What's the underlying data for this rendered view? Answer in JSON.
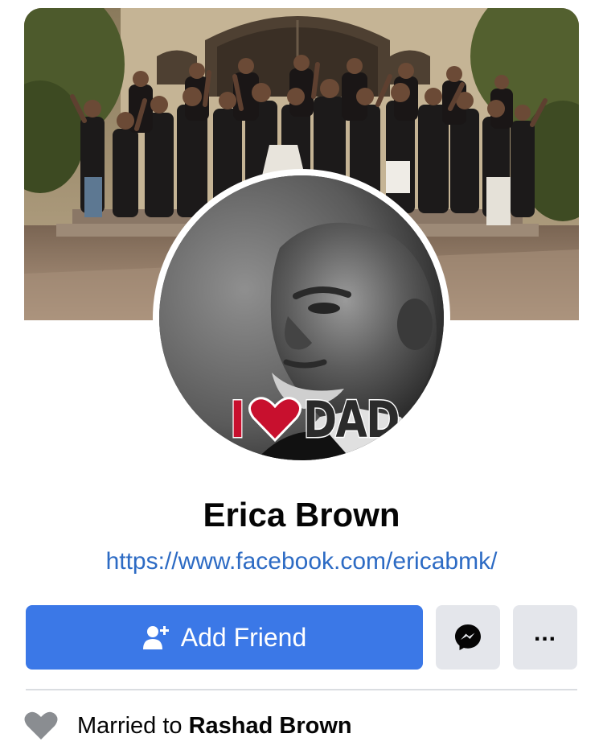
{
  "profile": {
    "name": "Erica Brown",
    "url": "https://www.facebook.com/ericabmk/",
    "avatar_badge": {
      "i": "I",
      "dad": "DAD"
    }
  },
  "actions": {
    "add_friend_label": "Add Friend",
    "add_friend_icon": "person-add-icon",
    "messenger_icon": "messenger-icon",
    "more_icon": "more-icon",
    "more_label": "..."
  },
  "details": {
    "relationship_prefix": "Married to",
    "relationship_partner": "Rashad Brown",
    "relationship_icon": "heart-icon"
  },
  "colors": {
    "primary": "#3b78e7",
    "link": "#2d6bc4",
    "secondary_button": "#e4e6eb",
    "badge_red": "#c8102e"
  }
}
